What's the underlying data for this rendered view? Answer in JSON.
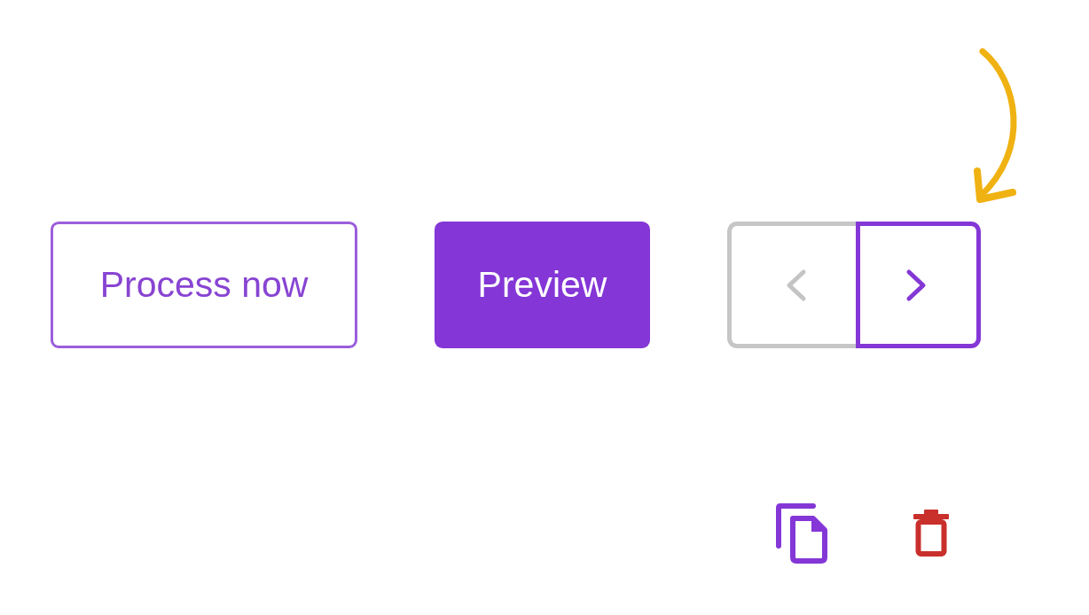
{
  "buttons": [
    {
      "label": "Process now",
      "kind": "outline"
    },
    {
      "label": "Preview",
      "kind": "filled"
    }
  ],
  "pager": [
    {
      "kind": "previous",
      "disabled": true
    },
    {
      "kind": "next",
      "disabled": false
    }
  ]
}
